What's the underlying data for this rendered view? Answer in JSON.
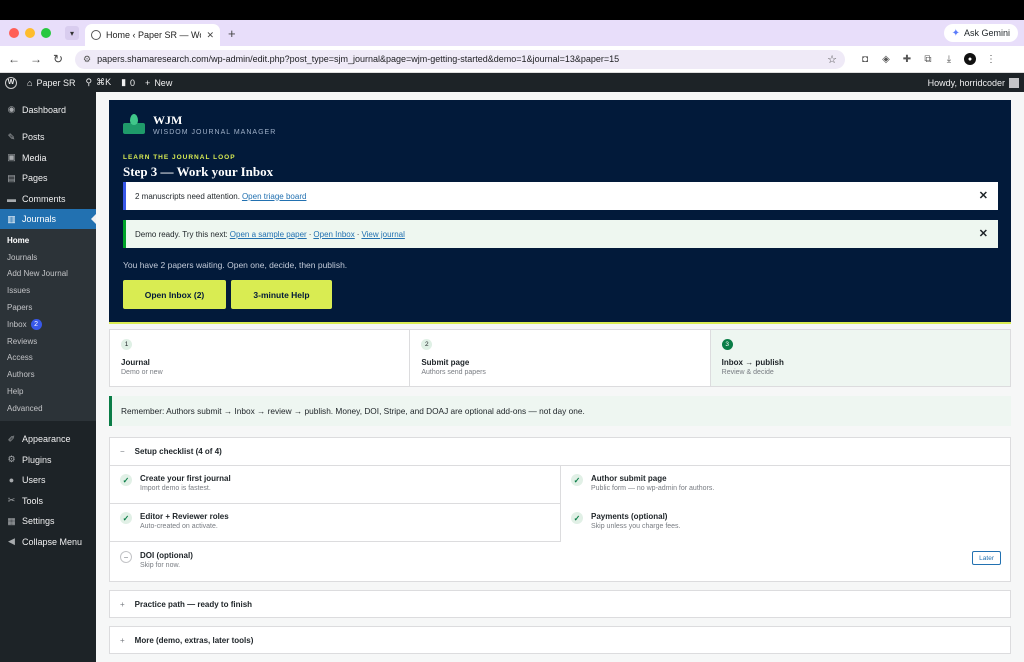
{
  "browser": {
    "tab_title": "Home ‹ Paper SR — WordPress",
    "tab_close": "✕",
    "new_tab": "+",
    "url": "papers.shamaresearch.com/wp-admin/edit.php?post_type=sjm_journal&page=wjm-getting-started&demo=1&journal=13&paper=15",
    "gemini_label": "Ask Gemini"
  },
  "adminbar": {
    "site_name": "Paper SR",
    "shortcut": "⌘K",
    "comments_count": "0",
    "new_label": "New",
    "howdy": "Howdy, horridcoder"
  },
  "sidebar": {
    "items": [
      {
        "label": "Dashboard",
        "icon": "◉"
      },
      {
        "label": "Posts",
        "icon": "✎"
      },
      {
        "label": "Media",
        "icon": "▣"
      },
      {
        "label": "Pages",
        "icon": "▤"
      },
      {
        "label": "Comments",
        "icon": "▬"
      },
      {
        "label": "Journals",
        "icon": "▥"
      }
    ],
    "submenu": [
      {
        "label": "Home"
      },
      {
        "label": "Journals"
      },
      {
        "label": "Add New Journal"
      },
      {
        "label": "Issues"
      },
      {
        "label": "Papers"
      },
      {
        "label": "Inbox",
        "badge": "2"
      },
      {
        "label": "Reviews"
      },
      {
        "label": "Access"
      },
      {
        "label": "Authors"
      },
      {
        "label": "Help"
      },
      {
        "label": "Advanced"
      }
    ],
    "bottom_items": [
      {
        "label": "Appearance",
        "icon": "✐"
      },
      {
        "label": "Plugins",
        "icon": "⚙"
      },
      {
        "label": "Users",
        "icon": "●"
      },
      {
        "label": "Tools",
        "icon": "✂"
      },
      {
        "label": "Settings",
        "icon": "▦"
      },
      {
        "label": "Collapse Menu",
        "icon": "◀"
      }
    ]
  },
  "hero": {
    "brand_title": "WJM",
    "brand_sub": "WISDOM JOURNAL MANAGER",
    "eyebrow": "LEARN THE JOURNAL LOOP",
    "step_title": "Step 3 — Work your Inbox",
    "notice1_text": "2 manuscripts need attention.",
    "notice1_link": "Open triage board",
    "notice2_text": "Demo ready. Try this next:",
    "notice2_link1": "Open a sample paper",
    "notice2_link2": "Open Inbox",
    "notice2_link3": "View journal",
    "separator": "·",
    "close": "✕",
    "waiting": "You have 2 papers waiting. Open one, decide, then publish.",
    "btn_inbox": "Open Inbox (2)",
    "btn_help": "3-minute Help"
  },
  "steps": [
    {
      "num": "1",
      "name": "Journal",
      "desc": "Demo or new"
    },
    {
      "num": "2",
      "name": "Submit page",
      "desc": "Authors send papers"
    },
    {
      "num": "3",
      "name": "Inbox → publish",
      "desc": "Review & decide"
    }
  ],
  "remember": "Remember: Authors submit → Inbox → review → publish. Money, DOI, Stripe, and DOAJ are optional add-ons — not day one.",
  "checklist": {
    "title": "Setup checklist (4 of 4)",
    "toggle": "−",
    "items": [
      {
        "name": "Create your first journal",
        "desc": "Import demo is fastest."
      },
      {
        "name": "Author submit page",
        "desc": "Public form — no wp-admin for authors."
      },
      {
        "name": "Editor + Reviewer roles",
        "desc": "Auto-created on activate."
      },
      {
        "name": "Payments (optional)",
        "desc": "Skip unless you charge fees."
      },
      {
        "name": "DOI (optional)",
        "desc": "Skip for now."
      }
    ],
    "check": "✓",
    "todo": "−",
    "later": "Later"
  },
  "sections": {
    "practice": "Practice path — ready to finish",
    "more": "More (demo, extras, later tools)",
    "toggle": "+"
  },
  "colors": {
    "hero_bg": "#021a3a",
    "accent": "#d9ec52",
    "wp_blue": "#2271b1"
  }
}
